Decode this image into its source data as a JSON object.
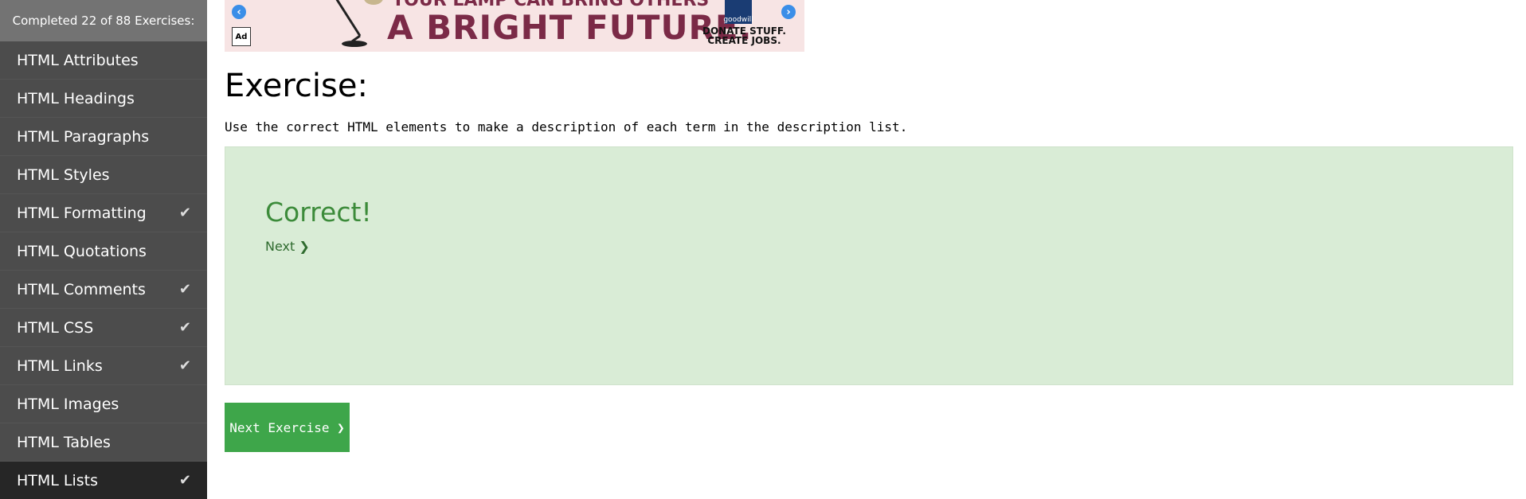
{
  "sidebar": {
    "progress_text": "Completed 22 of 88 Exercises:",
    "items": [
      {
        "label": "HTML Attributes",
        "checked": false
      },
      {
        "label": "HTML Headings",
        "checked": false
      },
      {
        "label": "HTML Paragraphs",
        "checked": false
      },
      {
        "label": "HTML Styles",
        "checked": false
      },
      {
        "label": "HTML Formatting",
        "checked": true
      },
      {
        "label": "HTML Quotations",
        "checked": false
      },
      {
        "label": "HTML Comments",
        "checked": true
      },
      {
        "label": "HTML CSS",
        "checked": true
      },
      {
        "label": "HTML Links",
        "checked": true
      },
      {
        "label": "HTML Images",
        "checked": false
      },
      {
        "label": "HTML Tables",
        "checked": false
      },
      {
        "label": "HTML Lists",
        "checked": true,
        "active": true
      }
    ],
    "check_glyph": "✔"
  },
  "ad": {
    "headline_top": "YOUR LAMP CAN BRING OTHERS",
    "headline_main": "A BRIGHT FUTURE.",
    "logo_text": "Ad",
    "goodwill_text": "goodwill",
    "donate_line1": "DONATE STUFF.",
    "donate_line2": "CREATE JOBS.",
    "prev_glyph": "‹",
    "next_glyph": "›",
    "accent_color": "#7b2a47"
  },
  "exercise": {
    "title": "Exercise:",
    "instruction": "Use the correct HTML elements to make a description of each term in the description list.",
    "result_title": "Correct!",
    "next_link": "Next ❯",
    "next_button": "Next Exercise ❯",
    "success_bg": "#d9ecd6",
    "button_color": "#3ea64a"
  }
}
